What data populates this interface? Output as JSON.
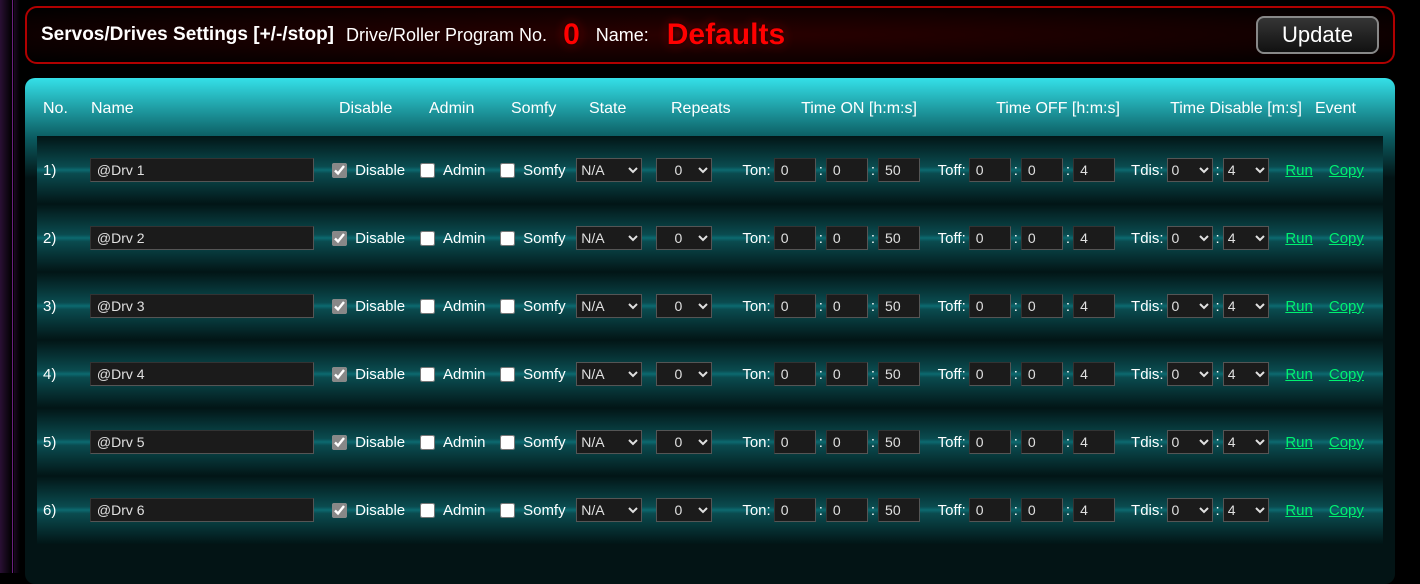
{
  "header": {
    "title": "Servos/Drives Settings [+/-/stop]",
    "sub_label": "Drive/Roller Program No.",
    "program_no": "0",
    "name_label": "Name:",
    "program_name": "Defaults",
    "update_label": "Update"
  },
  "columns": {
    "no": "No.",
    "name": "Name",
    "disable": "Disable",
    "admin": "Admin",
    "somfy": "Somfy",
    "state": "State",
    "repeats": "Repeats",
    "time_on": "Time ON [h:m:s]",
    "time_off": "Time OFF [h:m:s]",
    "time_disable": "Time Disable [m:s]",
    "event": "Event"
  },
  "labels": {
    "disable": "Disable",
    "admin": "Admin",
    "somfy": "Somfy",
    "ton": "Ton:",
    "toff": "Toff:",
    "tdis": "Tdis:",
    "run": "Run",
    "copy": "Copy"
  },
  "rows": [
    {
      "no": "1)",
      "name": "@Drv 1",
      "disable": true,
      "admin": false,
      "somfy": false,
      "state": "N/A",
      "repeats": "0",
      "ton": [
        "0",
        "0",
        "50"
      ],
      "toff": [
        "0",
        "0",
        "4"
      ],
      "tdis": [
        "0",
        "4"
      ]
    },
    {
      "no": "2)",
      "name": "@Drv 2",
      "disable": true,
      "admin": false,
      "somfy": false,
      "state": "N/A",
      "repeats": "0",
      "ton": [
        "0",
        "0",
        "50"
      ],
      "toff": [
        "0",
        "0",
        "4"
      ],
      "tdis": [
        "0",
        "4"
      ]
    },
    {
      "no": "3)",
      "name": "@Drv 3",
      "disable": true,
      "admin": false,
      "somfy": false,
      "state": "N/A",
      "repeats": "0",
      "ton": [
        "0",
        "0",
        "50"
      ],
      "toff": [
        "0",
        "0",
        "4"
      ],
      "tdis": [
        "0",
        "4"
      ]
    },
    {
      "no": "4)",
      "name": "@Drv 4",
      "disable": true,
      "admin": false,
      "somfy": false,
      "state": "N/A",
      "repeats": "0",
      "ton": [
        "0",
        "0",
        "50"
      ],
      "toff": [
        "0",
        "0",
        "4"
      ],
      "tdis": [
        "0",
        "4"
      ]
    },
    {
      "no": "5)",
      "name": "@Drv 5",
      "disable": true,
      "admin": false,
      "somfy": false,
      "state": "N/A",
      "repeats": "0",
      "ton": [
        "0",
        "0",
        "50"
      ],
      "toff": [
        "0",
        "0",
        "4"
      ],
      "tdis": [
        "0",
        "4"
      ]
    },
    {
      "no": "6)",
      "name": "@Drv 6",
      "disable": true,
      "admin": false,
      "somfy": false,
      "state": "N/A",
      "repeats": "0",
      "ton": [
        "0",
        "0",
        "50"
      ],
      "toff": [
        "0",
        "0",
        "4"
      ],
      "tdis": [
        "0",
        "4"
      ]
    }
  ]
}
